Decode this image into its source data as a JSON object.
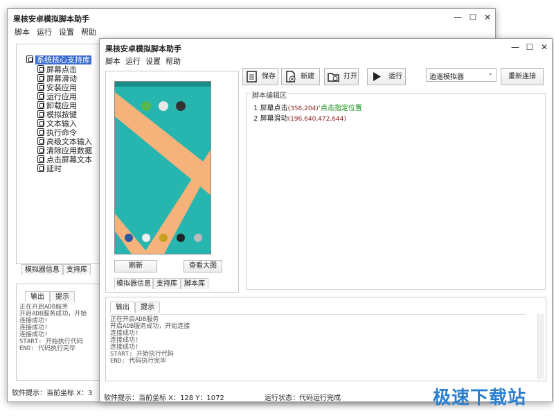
{
  "back_window": {
    "title": "果核安卓模拟脚本助手",
    "controls": [
      "—",
      "☐",
      "✕"
    ],
    "menu": [
      "脚本",
      "运行",
      "设置",
      "帮助"
    ],
    "tree": {
      "root": "系统核心支持库",
      "children": [
        "屏幕点击",
        "屏幕滑动",
        "安装应用",
        "运行应用",
        "卸载应用",
        "模拟按键",
        "文本输入",
        "执行命令",
        "高级文本输入",
        "清除应用数据",
        "点击屏幕文本",
        "延时"
      ]
    },
    "bottom_tabs": [
      "模拟器信息",
      "支持库"
    ],
    "output_tabs": [
      "输出",
      "提示"
    ],
    "output_text": "正在开启ADB服务\n开启ADB服务成功，开始\n连接成功!\n连接成功!\n连接成功!\nSTART: 开始执行代码\nEND: 代码执行完毕",
    "status": "软件提示：当前坐标 X：3"
  },
  "front_window": {
    "title": "果核安卓模拟脚本助手",
    "controls": [
      "—",
      "☐",
      "✕"
    ],
    "menu": [
      "脚本",
      "运行",
      "设置",
      "帮助"
    ],
    "preview_buttons": {
      "refresh": "刷新",
      "view_large": "查看大图"
    },
    "left_tabs": [
      "模拟器信息",
      "支持库",
      "脚本库"
    ],
    "toolbar": {
      "save": "保存",
      "new": "新建",
      "open": "打开",
      "run": "运行"
    },
    "emulator_select": "逍遥模拟器",
    "reconnect": "重新连接",
    "editor_label": "脚本编辑区",
    "script_lines": [
      {
        "num": "1",
        "cmd": "屏幕点击",
        "args": "(356,204)",
        "comment": "‘点击指定位置"
      },
      {
        "num": "2",
        "cmd": "屏幕滑动",
        "args": "(196,640,472,644)",
        "comment": ""
      }
    ],
    "output_tabs": [
      "输出",
      "提示"
    ],
    "output_text": "正在开启ADB服务\n开启ADB服务成功，开始连接\n连接成功!\n连接成功!\n连接成功!\nSTART: 开始执行代码\nEND: 代码执行完毕",
    "status_left": "软件提示：当前坐标 X：128 Y：1072",
    "status_right": "运行状态：代码运行完成"
  },
  "colors": {
    "selection": "#3b6ccf",
    "phone_bg": "#27b5b0",
    "stripe": "#f5b27a",
    "comment": "#1a8f1a",
    "args": "#8b1c1c"
  },
  "watermark": "极速下载站"
}
